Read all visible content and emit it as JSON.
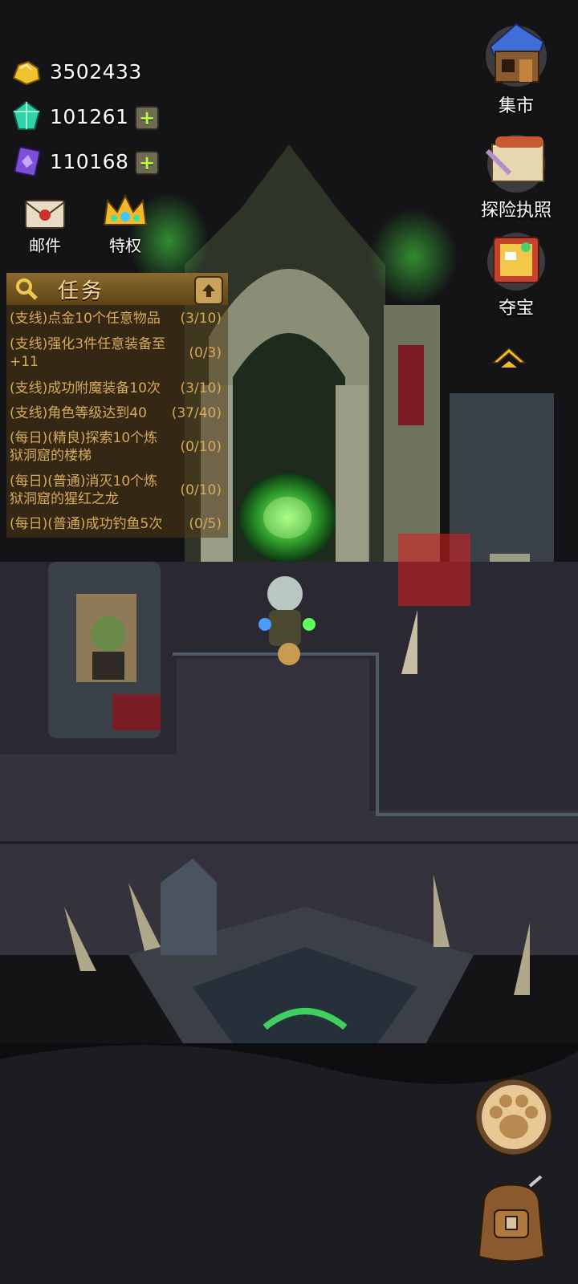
{
  "currencies": {
    "gold": {
      "value": "3502433",
      "icon": "gold-nugget-icon",
      "color": "#f2c12e"
    },
    "gems": {
      "value": "101261",
      "icon": "green-crystal-icon",
      "color": "#2fd3a6"
    },
    "tickets": {
      "value": "110168",
      "icon": "purple-card-icon",
      "color": "#7b4fd6"
    }
  },
  "top_buttons": {
    "mail": {
      "label": "邮件",
      "icon": "mail-envelope-icon"
    },
    "privilege": {
      "label": "特权",
      "icon": "crown-icon"
    }
  },
  "side_buttons": {
    "market": {
      "label": "集市",
      "icon": "market-house-icon"
    },
    "license": {
      "label": "探险执照",
      "icon": "scroll-quill-icon"
    },
    "treasure": {
      "label": "夺宝",
      "icon": "treasure-board-icon"
    }
  },
  "quests": {
    "title": "任务",
    "items": [
      {
        "text": "(支线)点金10个任意物品",
        "progress": "(3/10)"
      },
      {
        "text": "(支线)强化3件任意装备至+11",
        "progress": "(0/3)"
      },
      {
        "text": "(支线)成功附魔装备10次",
        "progress": "(3/10)"
      },
      {
        "text": "(支线)角色等级达到40",
        "progress": "(37/40)"
      },
      {
        "text": "(每日)(精良)探索10个炼狱洞窟的楼梯",
        "progress": "(0/10)"
      },
      {
        "text": "(每日)(普通)消灭10个炼狱洞窟的猩红之龙",
        "progress": "(0/10)"
      },
      {
        "text": "(每日)(普通)成功钓鱼5次",
        "progress": "(0/5)"
      }
    ]
  },
  "bottom_buttons": {
    "pet": {
      "icon": "paw-icon"
    },
    "inventory": {
      "icon": "backpack-icon"
    }
  },
  "colors": {
    "quest_text": "#d8a95a",
    "highlight": "#dc1e1e"
  }
}
